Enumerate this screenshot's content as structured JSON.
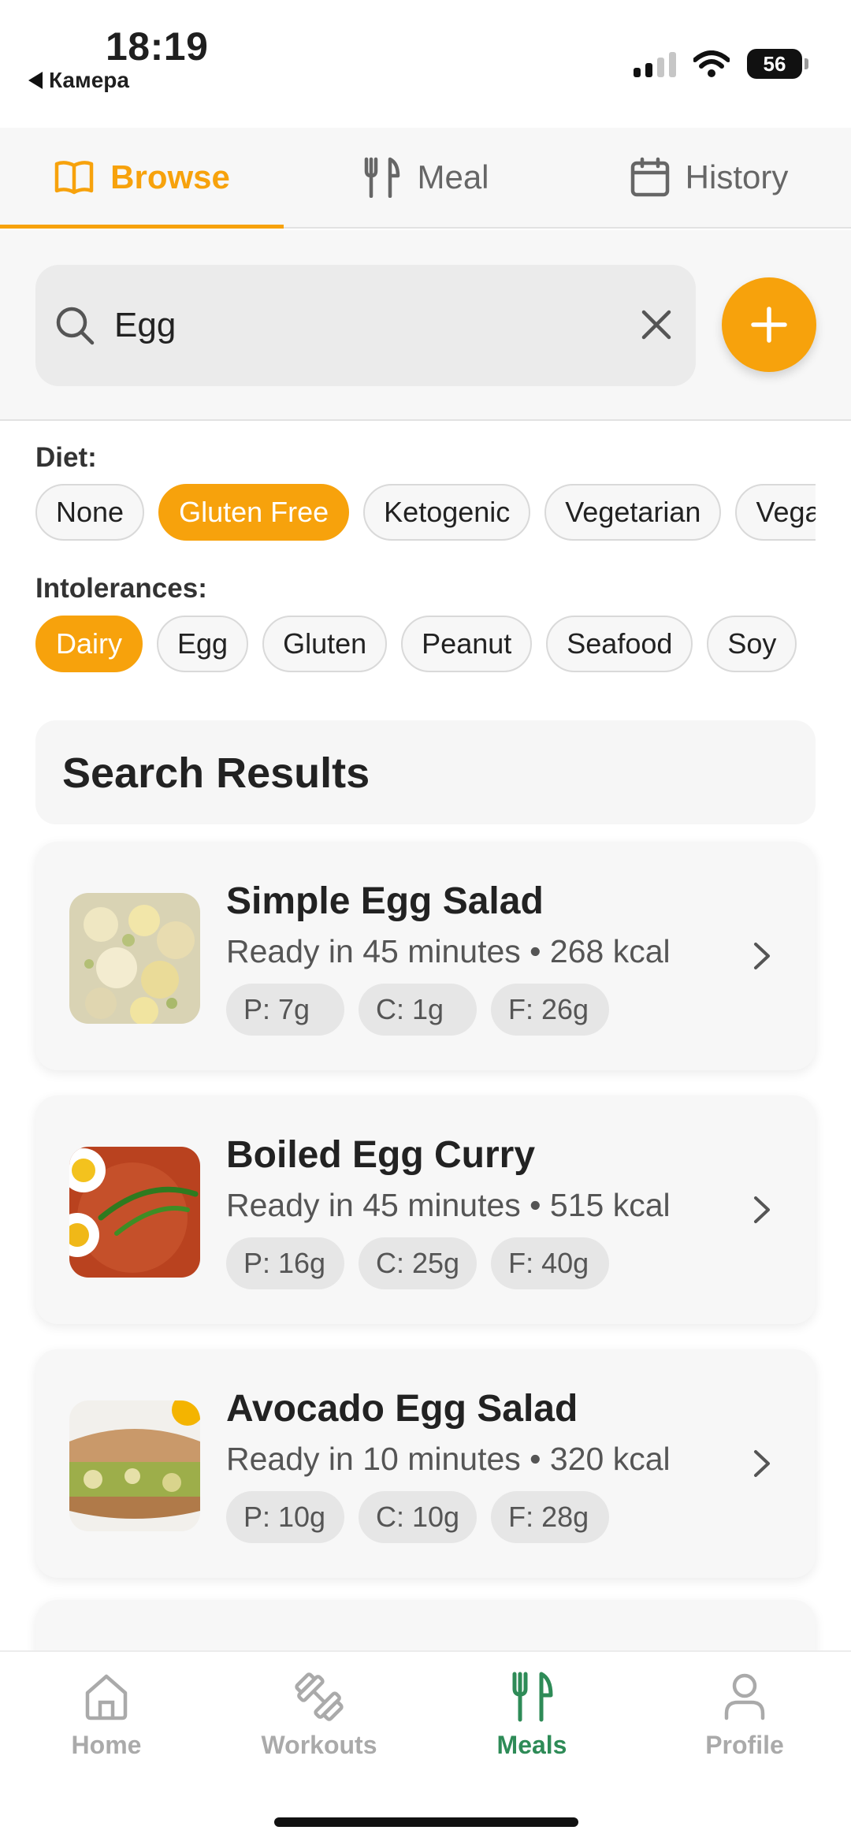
{
  "status_bar": {
    "time": "18:19",
    "back_app": "Камера",
    "battery": "56"
  },
  "tabs": [
    {
      "label": "Browse",
      "icon": "book-icon",
      "active": true
    },
    {
      "label": "Meal",
      "icon": "fork-knife-icon",
      "active": false
    },
    {
      "label": "History",
      "icon": "calendar-icon",
      "active": false
    }
  ],
  "search": {
    "value": "Egg",
    "placeholder": ""
  },
  "filters": {
    "diet_label": "Diet:",
    "diet": [
      "None",
      "Gluten Free",
      "Ketogenic",
      "Vegetarian",
      "Vegan"
    ],
    "diet_selected": "Gluten Free",
    "intolerances_label": "Intolerances:",
    "intolerances": [
      "Dairy",
      "Egg",
      "Gluten",
      "Peanut",
      "Seafood",
      "Soy"
    ],
    "intolerances_selected": "Dairy"
  },
  "results": {
    "title": "Search Results",
    "items": [
      {
        "name": "Simple Egg Salad",
        "meta": "Ready in 45 minutes • 268 kcal",
        "protein": "P: 7g",
        "carbs": "C: 1g",
        "fat": "F: 26g"
      },
      {
        "name": "Boiled Egg Curry",
        "meta": "Ready in 45 minutes • 515 kcal",
        "protein": "P: 16g",
        "carbs": "C: 25g",
        "fat": "F: 40g"
      },
      {
        "name": "Avocado Egg Salad",
        "meta": "Ready in 10 minutes • 320 kcal",
        "protein": "P: 10g",
        "carbs": "C: 10g",
        "fat": "F: 28g"
      }
    ]
  },
  "bottom_nav": [
    {
      "label": "Home",
      "icon": "home-icon",
      "active": false
    },
    {
      "label": "Workouts",
      "icon": "dumbbell-icon",
      "active": false
    },
    {
      "label": "Meals",
      "icon": "fork-knife-icon",
      "active": true
    },
    {
      "label": "Profile",
      "icon": "person-icon",
      "active": false
    }
  ],
  "colors": {
    "accent": "#f7a20c",
    "active_nav": "#2e8b57"
  }
}
